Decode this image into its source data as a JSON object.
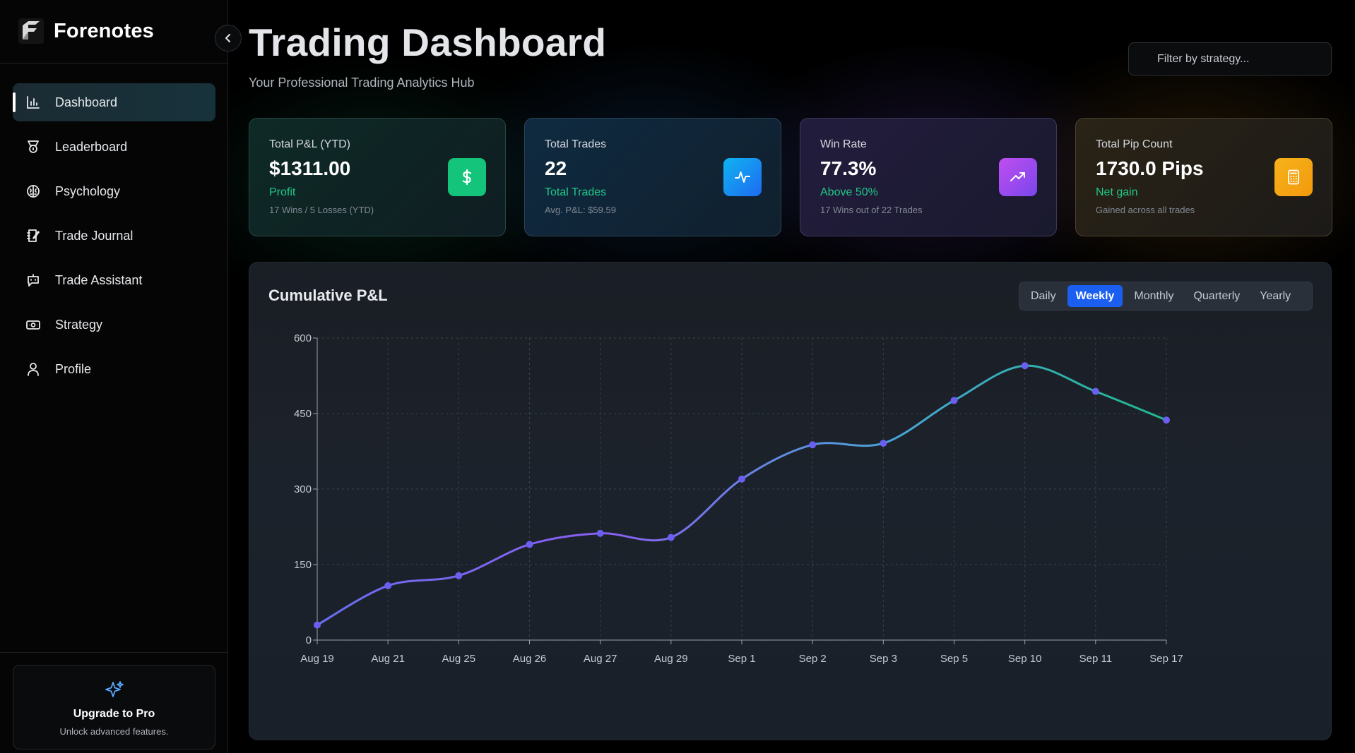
{
  "app": {
    "name": "Forenotes"
  },
  "sidebar": {
    "items": [
      {
        "label": "Dashboard",
        "icon": "bar-chart-icon",
        "active": true
      },
      {
        "label": "Leaderboard",
        "icon": "medal-icon",
        "active": false
      },
      {
        "label": "Psychology",
        "icon": "brain-icon",
        "active": false
      },
      {
        "label": "Trade Journal",
        "icon": "journal-icon",
        "active": false
      },
      {
        "label": "Trade Assistant",
        "icon": "bot-icon",
        "active": false
      },
      {
        "label": "Strategy",
        "icon": "banknote-icon",
        "active": false
      },
      {
        "label": "Profile",
        "icon": "user-icon",
        "active": false
      }
    ],
    "upgrade": {
      "title": "Upgrade to Pro",
      "subtitle": "Unlock advanced features.",
      "icon": "sparkles-icon"
    }
  },
  "header": {
    "title": "Trading Dashboard",
    "subtitle": "Your Professional Trading Analytics Hub",
    "filter_placeholder": "Filter by strategy..."
  },
  "cards": [
    {
      "label": "Total P&L (YTD)",
      "value": "$1311.00",
      "status": "Profit",
      "note": "17 Wins / 5 Losses (YTD)",
      "icon": "dollar-icon",
      "color": "#14c47a"
    },
    {
      "label": "Total Trades",
      "value": "22",
      "status": "Total Trades",
      "note": "Avg. P&L: $59.59",
      "icon": "activity-icon",
      "color": "#1e8bf2"
    },
    {
      "label": "Win Rate",
      "value": "77.3%",
      "status": "Above 50%",
      "note": "17 Wins out of 22 Trades",
      "icon": "trending-up-icon",
      "color": "#9a4aee"
    },
    {
      "label": "Total Pip Count",
      "value": "1730.0 Pips",
      "status": "Net gain",
      "note": "Gained across all trades",
      "icon": "calculator-icon",
      "color": "#f5a816"
    }
  ],
  "chart_panel": {
    "title": "Cumulative P&L",
    "ranges": [
      "Daily",
      "Weekly",
      "Monthly",
      "Quarterly",
      "Yearly"
    ],
    "active_range": "Weekly"
  },
  "chart_data": {
    "type": "line",
    "title": "Cumulative P&L",
    "categories": [
      "Aug 19",
      "Aug 21",
      "Aug 25",
      "Aug 26",
      "Aug 27",
      "Aug 29",
      "Sep 1",
      "Sep 2",
      "Sep 3",
      "Sep 5",
      "Sep 10",
      "Sep 11",
      "Sep 17"
    ],
    "series": [
      {
        "values": [
          30,
          108,
          128,
          190,
          212,
          204,
          320,
          388,
          391,
          476,
          545,
          494,
          437
        ]
      }
    ],
    "ylim": [
      0,
      600
    ],
    "yticks": [
      0,
      150,
      300,
      450,
      600
    ],
    "grid": true,
    "line_colors": [
      "#6a6ff0",
      "#8a5ef0",
      "#4aa3d8",
      "#1fb88e"
    ]
  }
}
